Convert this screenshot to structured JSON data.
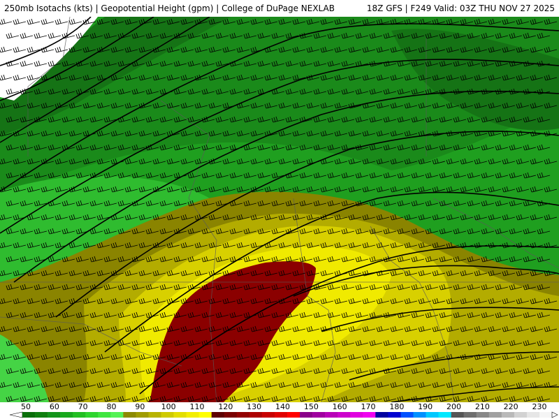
{
  "header": {
    "title_left": "250mb Isotachs (kts) | Geopotential Height (gpm) | College of DuPage NEXLAB",
    "title_right": "18Z GFS | F249 Valid: 03Z THU NOV 27 2025"
  },
  "colorbar": {
    "labels": [
      "50",
      "60",
      "70",
      "80",
      "90",
      "100",
      "110",
      "120",
      "130",
      "140",
      "150",
      "160",
      "170",
      "180",
      "190",
      "200",
      "210",
      "220",
      "230"
    ],
    "colors": [
      "#0a6e0a",
      "#0f7f0f",
      "#12941a",
      "#18a81c",
      "#22bf22",
      "#2ed52e",
      "#3fe63f",
      "#54f254",
      "#8c8a00",
      "#a09c00",
      "#b8b300",
      "#cfca00",
      "#e3de00",
      "#f3ee00",
      "#ffff00",
      "#5e0000",
      "#7a0000",
      "#930000",
      "#ad0000",
      "#c80000",
      "#e00000",
      "#ff0000",
      "#8a008a",
      "#a000a0",
      "#b800b8",
      "#cc00cc",
      "#e000e0",
      "#f000f0",
      "#0000a0",
      "#0000d0",
      "#0050ff",
      "#0090ff",
      "#00c8ff",
      "#00e8ff",
      "#555555",
      "#6e6e6e",
      "#878787",
      "#a0a0a0",
      "#b9b9b9",
      "#d2d2d2",
      "#e6e6e6",
      "#f5f5f5"
    ]
  },
  "map": {
    "colors": {
      "c50": "#157315",
      "c60": "#1a8a1a",
      "c70": "#1f9f1f",
      "c80": "#2fbc2f",
      "c90": "#45d445",
      "c100": "#8a8400",
      "c110": "#b3ac00",
      "c120": "#d8d000",
      "c130": "#f0ea00",
      "c140": "#8b0000",
      "white": "#ffffff"
    }
  }
}
